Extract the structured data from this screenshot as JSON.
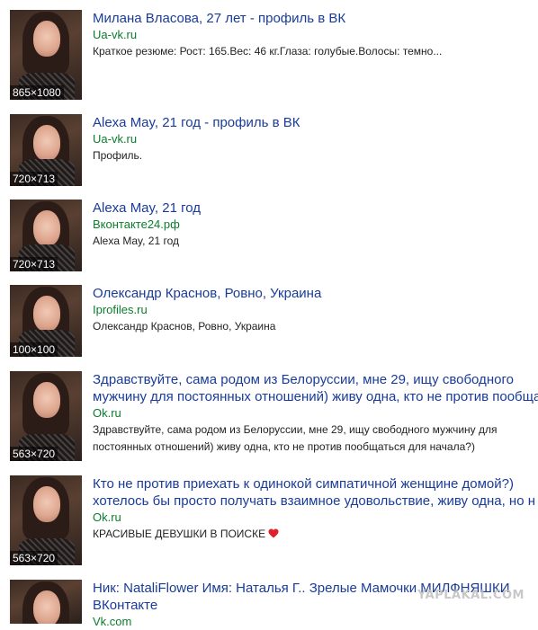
{
  "results": [
    {
      "title": "Милана Власова, 27 лет - профиль в ВК",
      "url": "Ua-vk.ru",
      "snippet": "Краткое резюме: Рост: 165.Вес: 46 кг.Глаза: голубые.Волосы: темно...",
      "size": "865×1080"
    },
    {
      "title": "Alexa May, 21 год - профиль в ВК",
      "url": "Ua-vk.ru",
      "snippet": "Профиль.",
      "size": "720×713"
    },
    {
      "title": "Alexa May, 21 год",
      "url": "Вконтакте24.рф",
      "snippet": "Alexa May, 21 год",
      "size": "720×713"
    },
    {
      "title": "Олександр Краснов, Ровно, Украина",
      "url": "Iprofiles.ru",
      "snippet": "Олександр Краснов, Ровно, Украина",
      "size": "100×100"
    },
    {
      "title_line1": "Здравствуйте, сама родом из Белоруссии, мне 29, ищу свободного",
      "title_line2": "мужчину для постоянных отношений) живу одна, кто не против пообща",
      "url": "Ok.ru",
      "snippet_line1": "Здравствуйте, сама родом из Белоруссии, мне 29, ищу свободного мужчину для",
      "snippet_line2": "постоянных отношений) живу одна, кто не против пообщаться для начала?)",
      "size": "563×720"
    },
    {
      "title_line1": "Кто не против приехать к одинокой симпатичной женщине домой?)",
      "title_line2": "хотелось бы просто получать взаимное удовольствие, живу одна, но н",
      "url": "Ok.ru",
      "snippet": "КРАСИВЫЕ ДЕВУШКИ В ПОИСКЕ",
      "size": "563×720"
    },
    {
      "title_line1": "Ник: NataliFlower Имя: Наталья Г.. Зрелые Мамочки МИЛФНЯШКИ",
      "title_line2": "ВКонтакте",
      "url": "Vk.com"
    }
  ],
  "watermark": "YAPLAKAL.COM",
  "colors": {
    "title": "#1a3c99",
    "url": "#0a7d2c",
    "snippet": "#222222",
    "heart": "#e0202a"
  },
  "icons": {
    "heart": "heart-icon"
  }
}
